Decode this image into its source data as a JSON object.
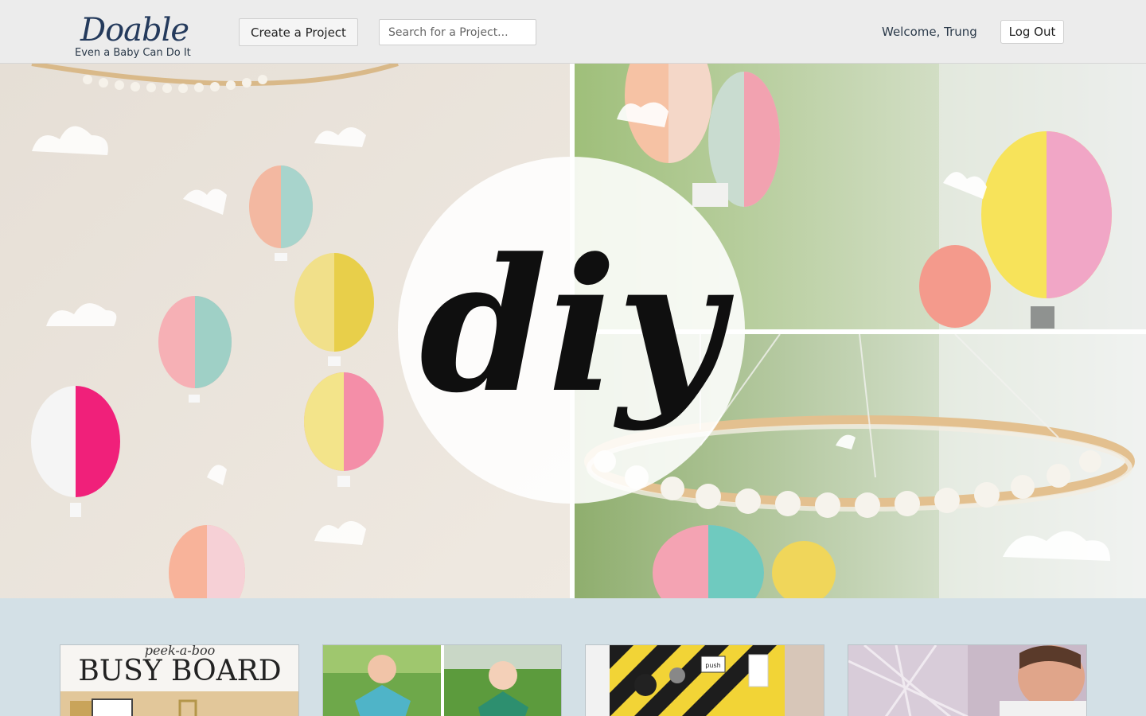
{
  "header": {
    "logo_title": "Doable",
    "logo_tagline": "Even a Baby Can Do It",
    "create_label": "Create a Project",
    "search_placeholder": "Search for a Project...",
    "welcome_text": "Welcome, Trung",
    "logout_label": "Log Out"
  },
  "hero": {
    "overlay_text": "diy"
  },
  "cards": [
    {
      "heading_small": "peek-a-boo",
      "heading": "BUSY BOARD"
    },
    {
      "heading": ""
    },
    {
      "label": "push"
    },
    {
      "heading": ""
    }
  ],
  "colors": {
    "header_bg": "#ececec",
    "page_bg": "#d3e0e6",
    "logo_text": "#243a5c"
  }
}
